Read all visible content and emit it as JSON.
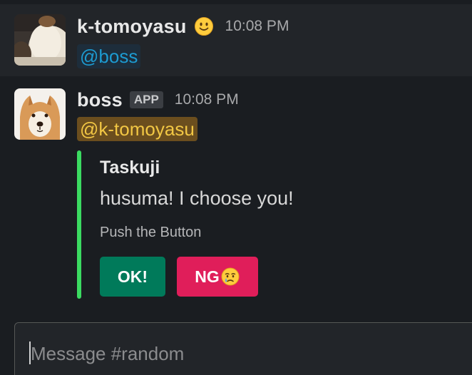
{
  "messages": [
    {
      "username": "k-tomoyasu",
      "status_emoji": "slightly-smiling-face",
      "timestamp": "10:08 PM",
      "mention": "@boss"
    },
    {
      "username": "boss",
      "badge": "APP",
      "timestamp": "10:08 PM",
      "mention": "@k-tomoyasu",
      "attachment": {
        "color": "#3bdb61",
        "title": "Taskuji",
        "text": "husuma! I choose you!",
        "subtext": "Push the Button",
        "buttons": [
          {
            "label": "OK!",
            "style": "primary",
            "color": "#007a5a"
          },
          {
            "label": "NG",
            "style": "danger",
            "color": "#e01e5a",
            "emoji": "crying-face"
          }
        ]
      }
    }
  ],
  "composer": {
    "placeholder": "Message #random"
  },
  "colors": {
    "background": "#1a1d21",
    "highlight_row": "#222529",
    "mention_blue": "#1d9bd1",
    "mention_gold": "#f2c744"
  }
}
